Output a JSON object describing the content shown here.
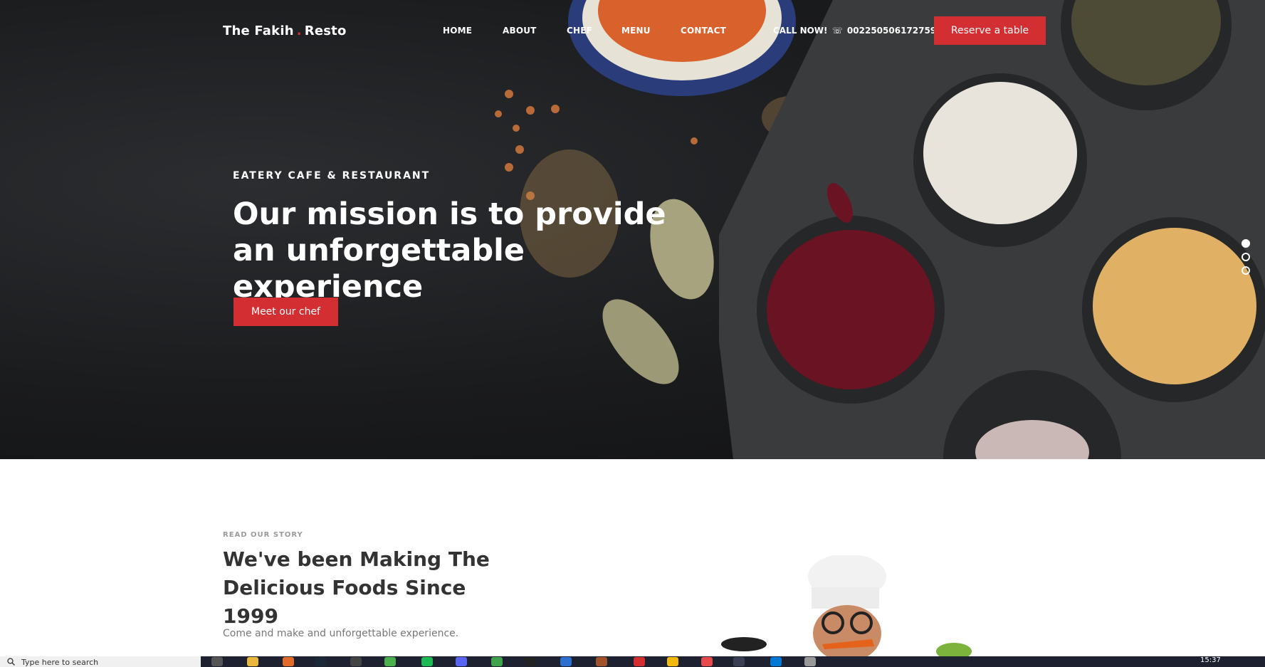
{
  "header": {
    "brand_left": "The Fakih",
    "brand_dot": ".",
    "brand_right": "Resto",
    "nav": [
      "HOME",
      "ABOUT",
      "CHEF",
      "MENU",
      "CONTACT"
    ],
    "call_label": "CALL NOW!",
    "phone": "002250506172759",
    "reserve_label": "Reserve a table"
  },
  "hero": {
    "eyebrow": "EATERY CAFE & RESTAURANT",
    "headline": "Our mission is to provide an unforgettable experience",
    "cta_label": "Meet our chef",
    "slides": 3,
    "active_slide": 1
  },
  "story": {
    "eyebrow": "READ OUR STORY",
    "title": "We've been Making The Delicious Foods Since 1999",
    "text": "Come and make and unforgettable experience."
  },
  "taskbar": {
    "search_placeholder": "Type here to search",
    "time": "15:37",
    "icons": [
      "task-view-icon",
      "file-explorer-icon",
      "firefox-icon",
      "steam-icon",
      "terminal-icon",
      "chrome-icon",
      "spotify-icon",
      "discord-icon",
      "app-icon",
      "epic-games-icon",
      "photoshop-icon",
      "game-icon",
      "opera-icon",
      "binance-icon",
      "app-icon",
      "app-icon",
      "vscode-icon",
      "app-icon"
    ]
  },
  "colors": {
    "accent": "#d32f32",
    "hero_bg": "#1a1b1d",
    "text_dark": "#333333"
  }
}
